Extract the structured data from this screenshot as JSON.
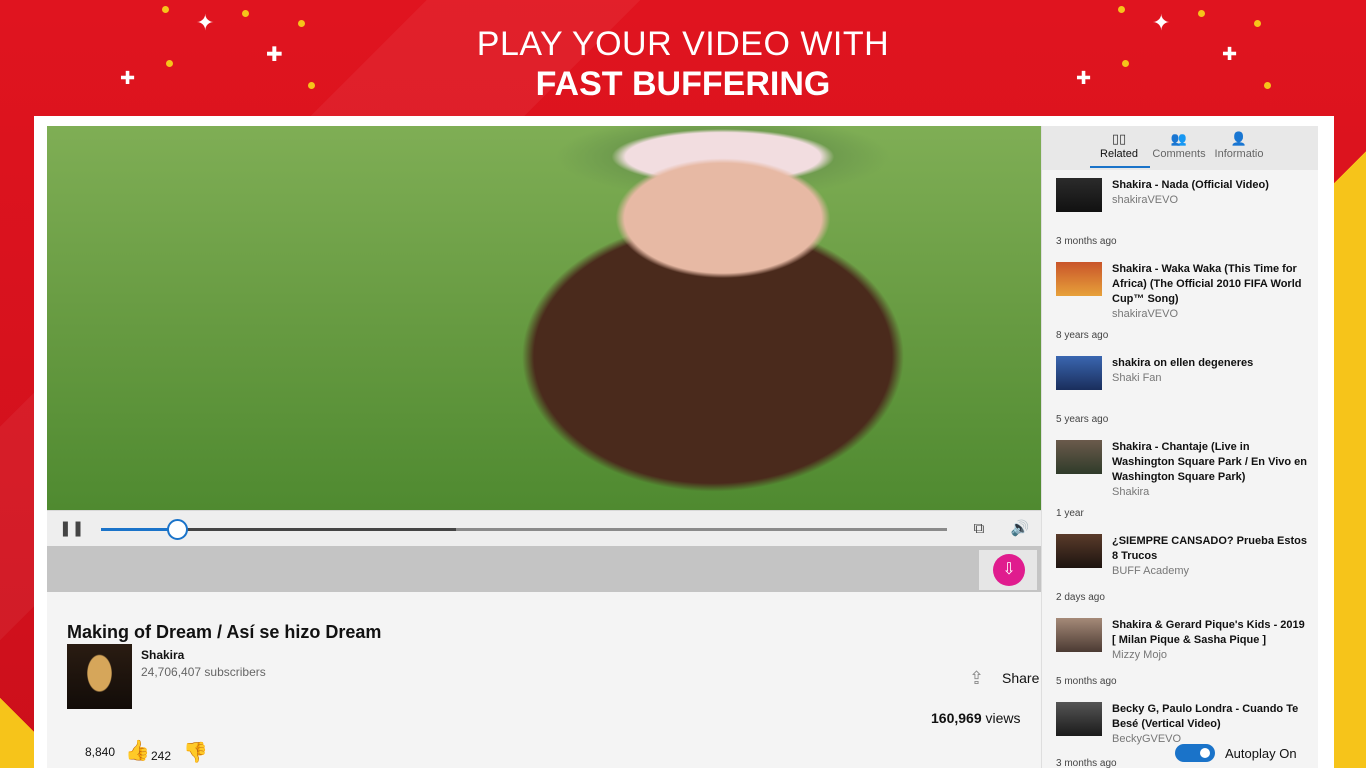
{
  "promo": {
    "headline_line1": "PLAY YOUR VIDEO WITH",
    "headline_line2": "FAST BUFFERING",
    "colors": {
      "red": "#d8121f",
      "yellow": "#f6c41a",
      "accent_blue": "#1a73c9",
      "download_pink": "#e01c8e"
    }
  },
  "player": {
    "progress_fraction": 0.09,
    "buffered_fraction": 0.42,
    "icons": {
      "pause": "pause-icon",
      "cast": "cast-icon",
      "volume": "volume-icon",
      "download": "download-icon"
    }
  },
  "video": {
    "title": "Making of Dream / Así se hizo Dream",
    "channel": "Shakira",
    "subscribers": "24,706,407 subscribers",
    "share_label": "Share",
    "views_count": "160,969",
    "views_suffix": " views",
    "likes": "8,840",
    "dislikes": "242"
  },
  "sidebar": {
    "tabs": [
      {
        "label": "Related",
        "icon": "book-icon",
        "active": true
      },
      {
        "label": "Comments",
        "icon": "people-icon",
        "active": false
      },
      {
        "label": "Informatio",
        "icon": "person-icon",
        "active": false
      }
    ],
    "items": [
      {
        "title": "Shakira - Nada (Official Video)",
        "channel": "shakiraVEVO",
        "age": "3 months ago"
      },
      {
        "title": "Shakira - Waka Waka (This Time for Africa) (The Official 2010 FIFA World Cup™ Song)",
        "channel": "shakiraVEVO",
        "age": "8 years ago"
      },
      {
        "title": "shakira on ellen degeneres",
        "channel": "Shaki Fan",
        "age": "5 years ago"
      },
      {
        "title": "Shakira - Chantaje (Live in Washington Square Park / En Vivo en Washington Square Park)",
        "channel": "Shakira",
        "age": "1 year"
      },
      {
        "title": "¿SIEMPRE CANSADO? Prueba Estos 8 Trucos",
        "channel": "BUFF Academy",
        "age": "2 days ago"
      },
      {
        "title": "Shakira & Gerard Pique's Kids - 2019 [ Milan Pique & Sasha Pique ]",
        "channel": "Mizzy Mojo",
        "age": "5 months ago"
      },
      {
        "title": "Becky G, Paulo Londra - Cuando Te Besé (Vertical Video)",
        "channel": "BeckyGVEVO",
        "age": "3 months ago"
      }
    ],
    "autoplay_label": "Autoplay On",
    "autoplay_on": true
  }
}
